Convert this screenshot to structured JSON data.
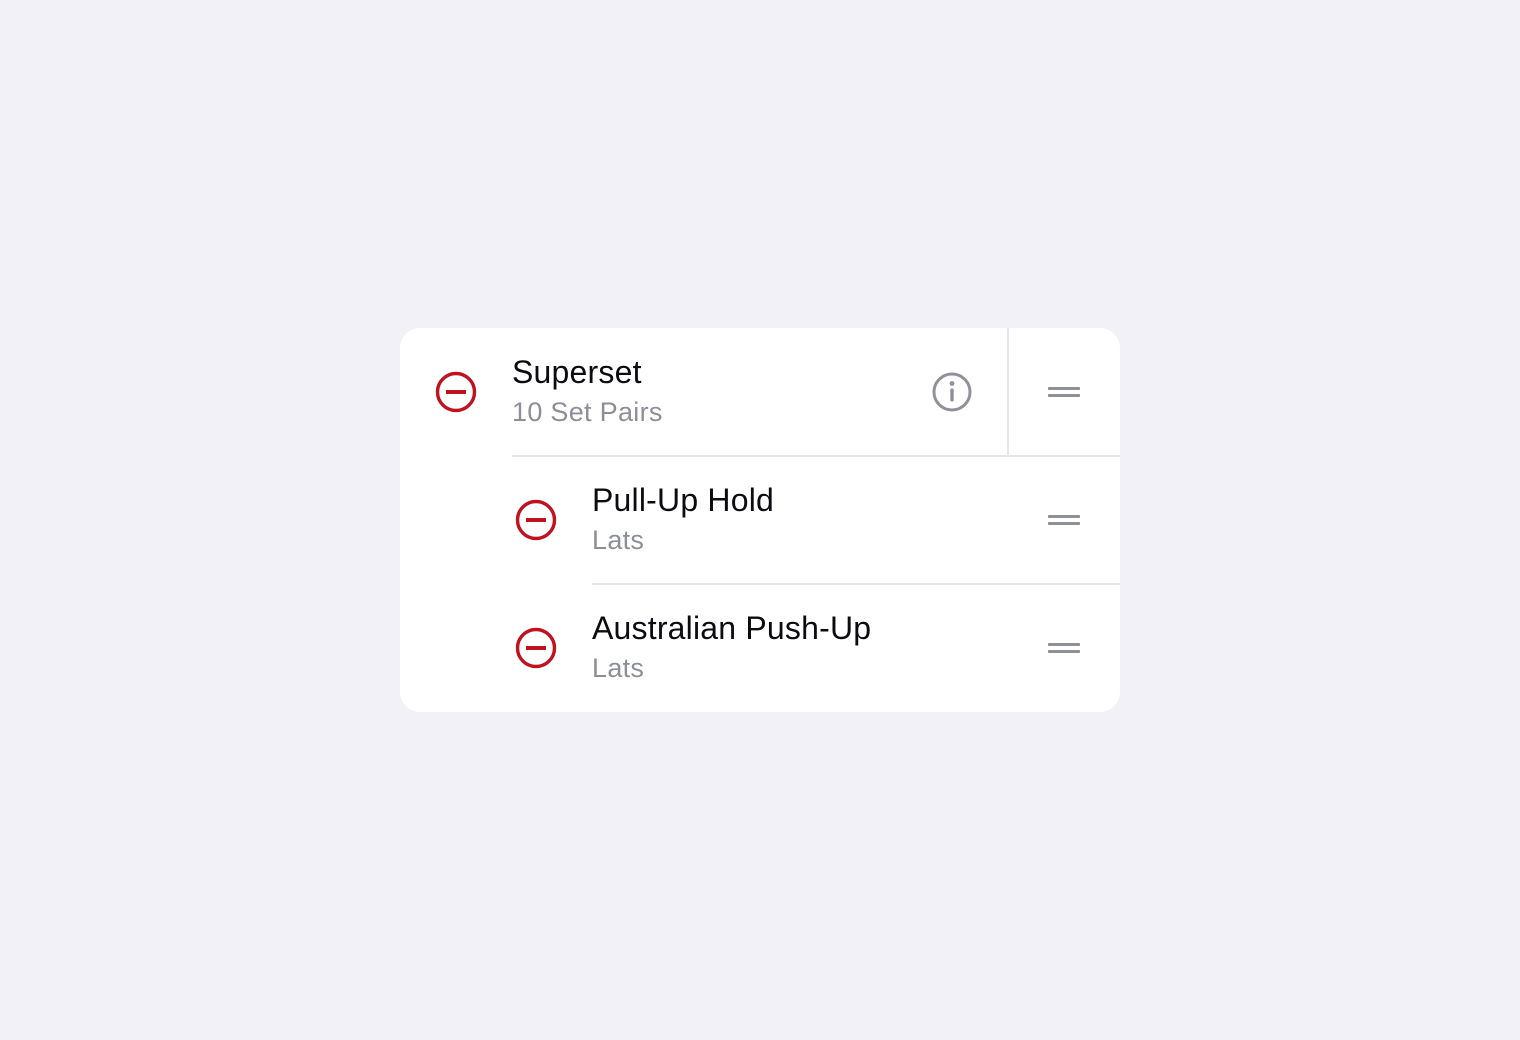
{
  "colors": {
    "background": "#f2f1f7",
    "card": "#ffffff",
    "delete_accent": "#c0111f",
    "secondary_text": "#8e8e9a",
    "icon_gray": "#90909c"
  },
  "superset": {
    "title": "Superset",
    "subtitle": "10 Set Pairs",
    "icons": {
      "delete": "minus-circle-icon",
      "info": "info-icon",
      "reorder": "drag-handle-icon"
    }
  },
  "exercises": [
    {
      "name": "Pull-Up Hold",
      "muscle": "Lats"
    },
    {
      "name": "Australian Push-Up",
      "muscle": "Lats"
    }
  ]
}
